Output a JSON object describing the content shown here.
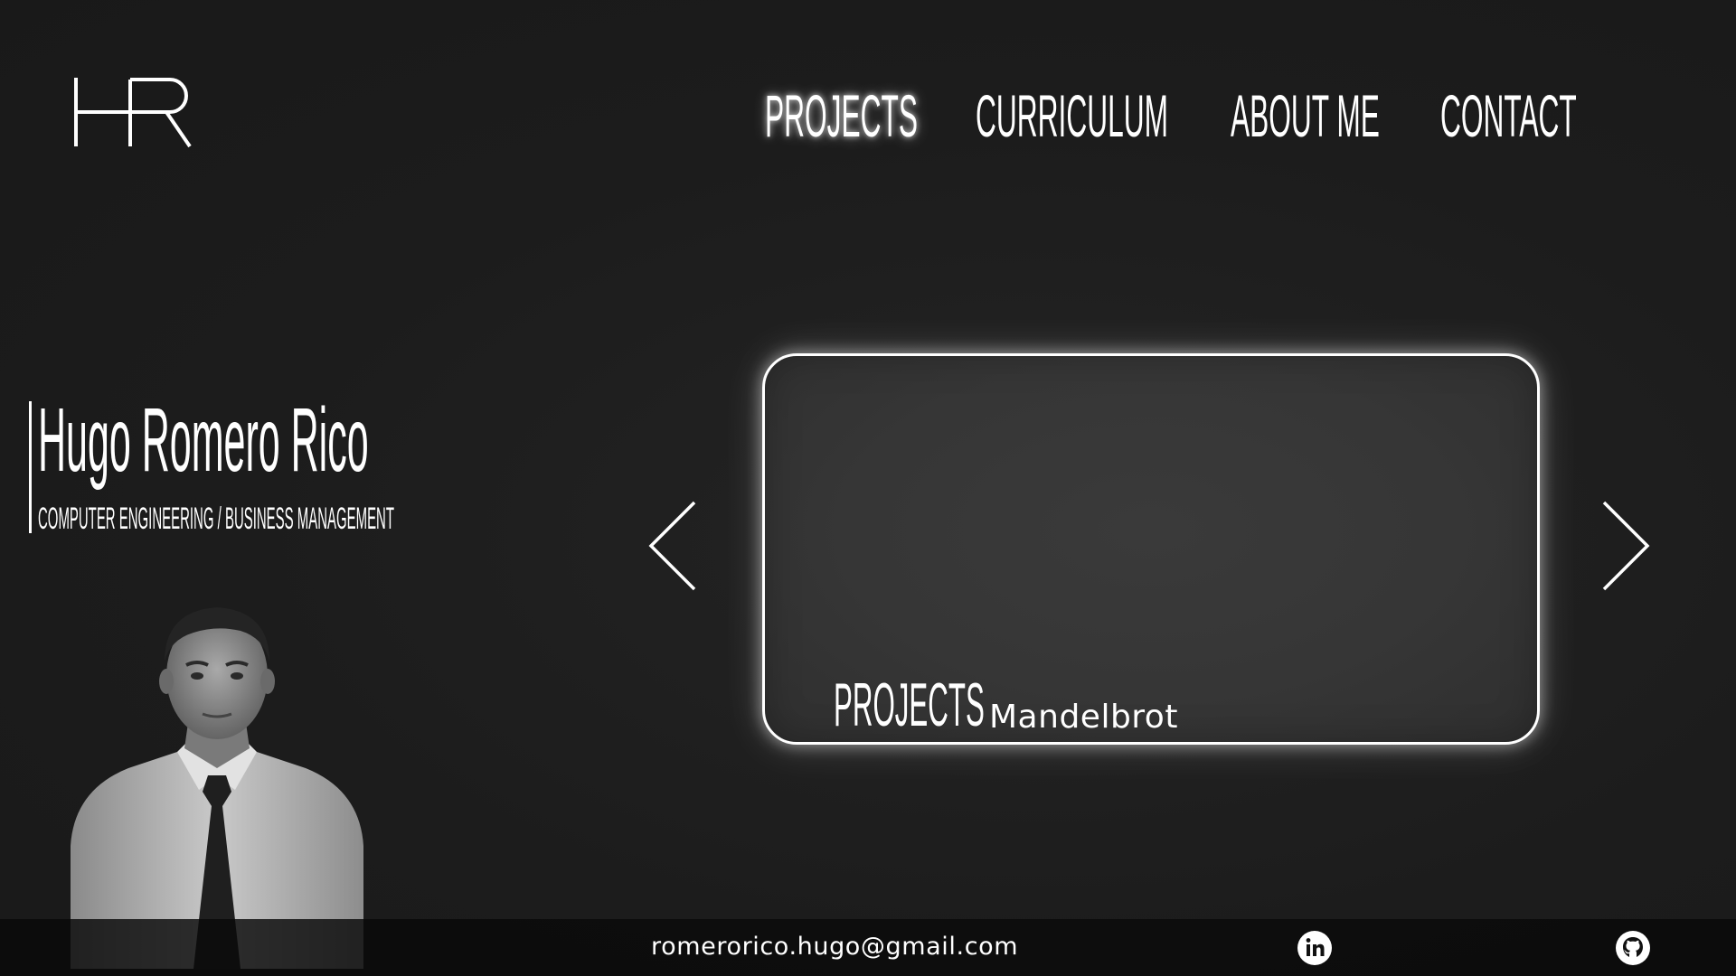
{
  "header": {
    "logo_text": "HR",
    "nav": {
      "projects": "PROJECTS",
      "curriculum": "CURRICULUM",
      "about": "ABOUT ME",
      "contact": "CONTACT"
    },
    "active_nav": "projects"
  },
  "profile": {
    "name": "Hugo Romero Rico",
    "subtitle": "COMPUTER ENGINEERING / BUSINESS MANAGEMENT"
  },
  "carousel": {
    "section_label": "PROJECTS",
    "current_title": "Mandelbrot"
  },
  "footer": {
    "email": "romerorico.hugo@gmail.com",
    "icons": [
      "linkedin-icon",
      "github-icon"
    ]
  },
  "colors": {
    "background": "#1b1b1b",
    "text": "#ffffff",
    "card": "#363636",
    "footer": "#0a0a0a"
  }
}
